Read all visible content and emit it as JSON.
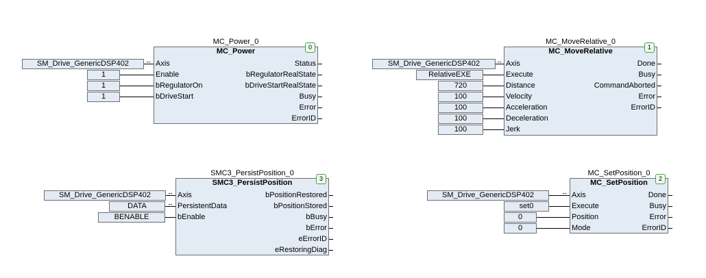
{
  "blocks": {
    "power": {
      "instance": "MC_Power_0",
      "type": "MC_Power",
      "index": "0",
      "inputs": [
        "Axis",
        "Enable",
        "bRegulatorOn",
        "bDriveStart"
      ],
      "outputs": [
        "Status",
        "bRegulatorRealState",
        "bDriveStartRealState",
        "Busy",
        "Error",
        "ErrorID"
      ],
      "vars": [
        "SM_Drive_GenericDSP402",
        "1",
        "1",
        "1"
      ]
    },
    "moverel": {
      "instance": "MC_MoveRelative_0",
      "type": "MC_MoveRelative",
      "index": "1",
      "inputs": [
        "Axis",
        "Execute",
        "Distance",
        "Velocity",
        "Acceleration",
        "Deceleration",
        "Jerk"
      ],
      "outputs": [
        "Done",
        "Busy",
        "CommandAborted",
        "Error",
        "ErrorID"
      ],
      "vars": [
        "SM_Drive_GenericDSP402",
        "RelativeEXE",
        "720",
        "100",
        "100",
        "100",
        "100"
      ]
    },
    "persist": {
      "instance": "SMC3_PersistPosition_0",
      "type": "SMC3_PersistPosition",
      "index": "3",
      "inputs": [
        "Axis",
        "PersistentData",
        "bEnable"
      ],
      "outputs": [
        "bPositionRestored",
        "bPositionStored",
        "bBusy",
        "bError",
        "eErrorID",
        "eRestoringDiag"
      ],
      "vars": [
        "SM_Drive_GenericDSP402",
        "DATA",
        "BENABLE"
      ]
    },
    "setpos": {
      "instance": "MC_SetPosition_0",
      "type": "MC_SetPosition",
      "index": "2",
      "inputs": [
        "Axis",
        "Execute",
        "Position",
        "Mode"
      ],
      "outputs": [
        "Done",
        "Busy",
        "Error",
        "ErrorID"
      ],
      "vars": [
        "SM_Drive_GenericDSP402",
        "set0",
        "0",
        "0"
      ]
    }
  }
}
